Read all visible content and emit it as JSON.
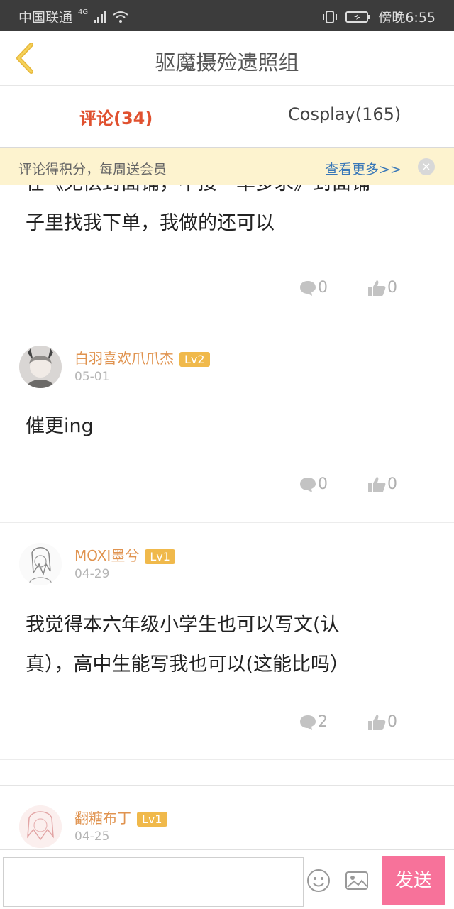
{
  "status_bar": {
    "carrier": "中国联通",
    "network": "4G",
    "time": "傍晚6:55"
  },
  "header": {
    "title": "驱魔摄殓遗照组"
  },
  "tabs": [
    {
      "label": "评论(34)",
      "active": true
    },
    {
      "label": "Cosplay(165)",
      "active": false
    }
  ],
  "notice": {
    "text": "评论得积分，每周送会员",
    "more": "查看更多>>",
    "close": "×"
  },
  "comments": [
    {
      "text_lines": [
        "在《无偿封面铺，不接一单多求》封面铺",
        "子里找我下单，我做的还可以"
      ],
      "replies": "0",
      "likes": "0"
    },
    {
      "username": "白羽喜欢爪爪杰",
      "level": "Lv2",
      "date": "05-01",
      "text_lines": [
        "催更ing"
      ],
      "replies": "0",
      "likes": "0"
    },
    {
      "username": "MOXI墨兮",
      "level": "Lv1",
      "date": "04-29",
      "text_lines": [
        "我觉得本六年级小学生也可以写文(认",
        "真），高中生能写我也可以(这能比吗）"
      ],
      "replies": "2",
      "likes": "0"
    },
    {
      "username": "翻糖布丁",
      "level": "Lv1",
      "date": "04-25"
    }
  ],
  "bottom_bar": {
    "input_placeholder": "",
    "send_label": "发送"
  },
  "colors": {
    "accent": "#e0512f",
    "username": "#e0934f",
    "level_badge": "#f0b94b",
    "send_button": "#f7729a",
    "notice_bg": "#fdf3cf",
    "link": "#3a78b8"
  }
}
